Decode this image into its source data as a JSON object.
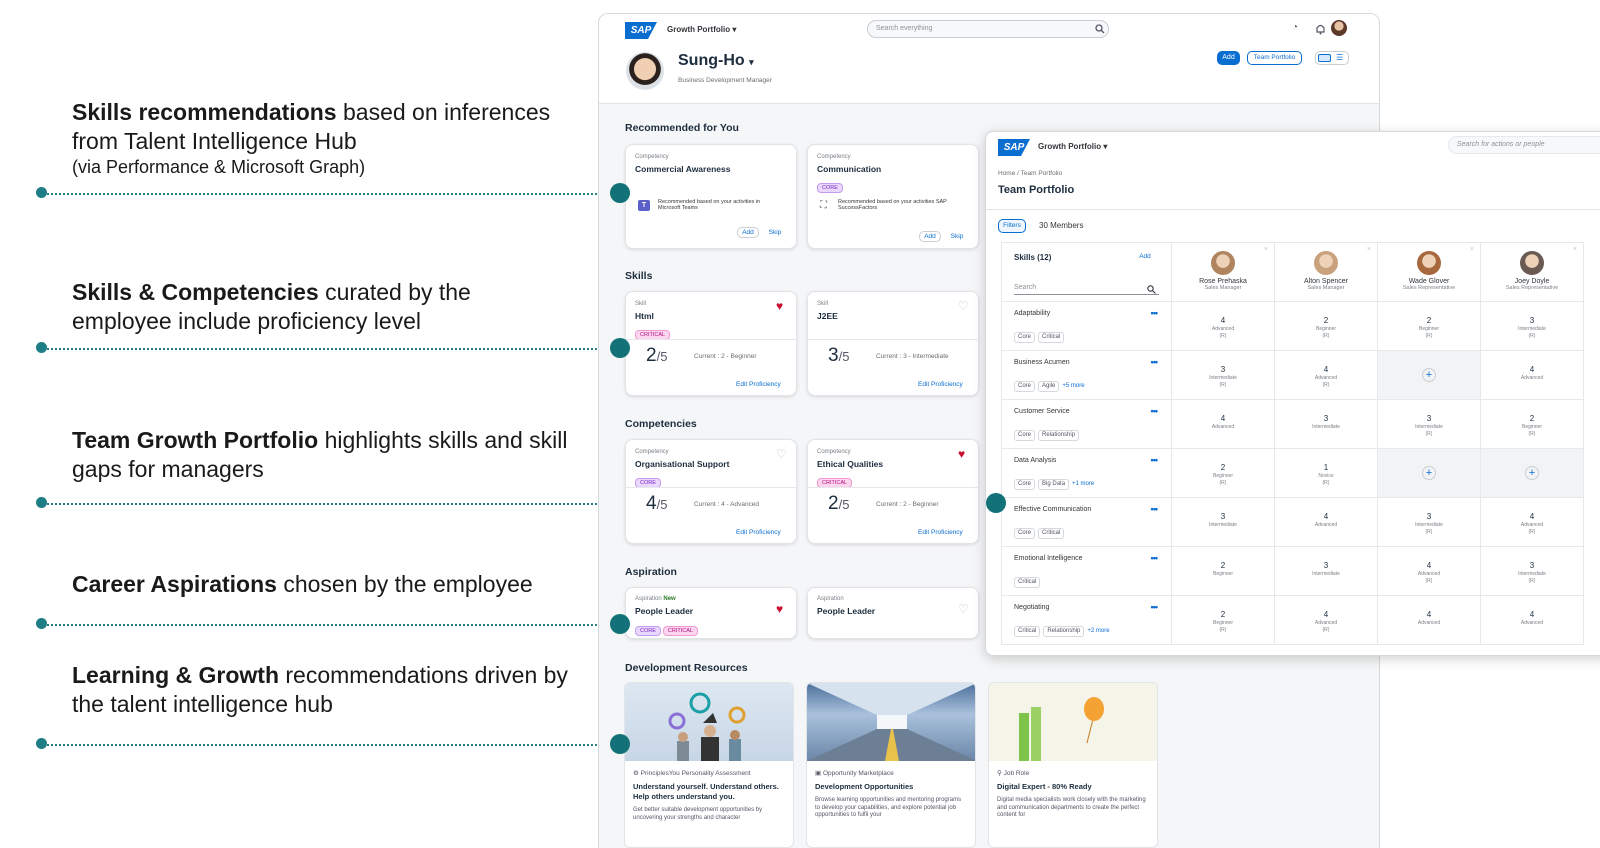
{
  "annotations": [
    {
      "bold": "Skills recommendations",
      "rest": " based on inferences from Talent Intelligence Hub",
      "sub": "(via Performance & Microsoft Graph)"
    },
    {
      "bold": "Skills & Competencies",
      "rest": " curated by the employee include proficiency level",
      "sub": ""
    },
    {
      "bold": "Team Growth Portfolio",
      "rest": " highlights skills and skill gaps for managers",
      "sub": ""
    },
    {
      "bold": "Career Aspirations",
      "rest": " chosen by the employee",
      "sub": ""
    },
    {
      "bold": "Learning & Growth",
      "rest": " recommendations driven by the talent intelligence hub",
      "sub": ""
    }
  ],
  "app": {
    "logo": "SAP",
    "product": "Growth Portfolio",
    "search_placeholder": "Search everything",
    "user_name": "Sung-Ho",
    "user_title": "Business Development Manager",
    "add_label": "Add",
    "team_portfolio_label": "Team Portfolio"
  },
  "recommended": {
    "title": "Recommended for You",
    "cards": [
      {
        "type": "Competency",
        "name": "Commercial Awareness",
        "tags": [],
        "reason": "Recommended based on your activities in Microsoft Teams",
        "add": "Add",
        "skip": "Skip"
      },
      {
        "type": "Competency",
        "name": "Communication",
        "tags": [
          "CORE"
        ],
        "reason": "Recommended based on your activities SAP SuccessFactors",
        "add": "Add",
        "skip": "Skip"
      }
    ]
  },
  "skills": {
    "title": "Skills",
    "cards": [
      {
        "type": "Skill",
        "name": "Html",
        "tag": "CRITICAL",
        "score": "2",
        "of": "/5",
        "current": "Current : 2 - Beginner",
        "edit": "Edit Proficiency",
        "fav": true
      },
      {
        "type": "Skill",
        "name": "J2EE",
        "tag": "",
        "score": "3",
        "of": "/5",
        "current": "Current : 3 - Intermediate",
        "edit": "Edit Proficiency",
        "fav": false
      }
    ]
  },
  "competencies": {
    "title": "Competencies",
    "cards": [
      {
        "type": "Competency",
        "name": "Organisational Support",
        "tag": "CORE",
        "score": "4",
        "of": "/5",
        "current": "Current : 4 - Advanced",
        "edit": "Edit Proficiency",
        "fav": false
      },
      {
        "type": "Competency",
        "name": "Ethical Qualities",
        "tag": "CRITICAL",
        "score": "2",
        "of": "/5",
        "current": "Current : 2 - Beginner",
        "edit": "Edit Proficiency",
        "fav": true
      }
    ]
  },
  "aspiration": {
    "title": "Aspiration",
    "cards": [
      {
        "type": "Aspiration",
        "badge": "New",
        "name": "People Leader",
        "tags": [
          "CORE",
          "CRITICAL"
        ],
        "fav": true
      },
      {
        "type": "Aspiration",
        "badge": "",
        "name": "People Leader",
        "tags": [],
        "fav": false
      }
    ]
  },
  "dev_resources": {
    "title": "Development Resources",
    "cards": [
      {
        "category": "PrinciplesYou Personality Assessment",
        "title": "Understand yourself. Understand others. Help others understand you.",
        "desc": "Get better suitable development opportunities by uncovering your strengths and character"
      },
      {
        "category": "Opportunity Marketplace",
        "title": "Development Opportunities",
        "desc": "Browse learning opportunities and mentoring programs to develop your capabilities, and explore potential job opportunities to fulfil your"
      },
      {
        "category": "Job Role",
        "title": "Digital Expert - 80% Ready",
        "desc": "Digital media specialists work closely with the marketing and communication departments to create the perfect content for"
      }
    ]
  },
  "team": {
    "logo": "SAP",
    "product": "Growth Portfolio",
    "search_placeholder": "Search for actions or people",
    "breadcrumb": "Home / Team Portfolio",
    "title": "Team Portfolio",
    "filters": "Filters",
    "members": "30 Members",
    "skills_header": "Skills (12)",
    "add": "Add",
    "search": "Search",
    "people": [
      {
        "name": "Rose Prehaska",
        "role": "Sales Manager",
        "color": "#b0845f"
      },
      {
        "name": "Alton Spencer",
        "role": "Sales Manager",
        "color": "#c9a27d"
      },
      {
        "name": "Wade Glover",
        "role": "Sales Representative",
        "color": "#a8683e"
      },
      {
        "name": "Joey Doyle",
        "role": "Sales Representative",
        "color": "#6b5a52"
      }
    ],
    "rows": [
      {
        "skill": "Adaptability",
        "tags": [
          "Core",
          "Critical"
        ],
        "more": "",
        "cells": [
          [
            "4",
            "Advanced",
            "(R)"
          ],
          [
            "2",
            "Beginner",
            "(R)"
          ],
          [
            "2",
            "Beginner",
            "(R)"
          ],
          [
            "3",
            "Intermediate",
            "(R)"
          ]
        ]
      },
      {
        "skill": "Business Acumen",
        "tags": [
          "Core",
          "Agile"
        ],
        "more": "+5 more",
        "cells": [
          [
            "3",
            "Intermediate",
            "(R)"
          ],
          [
            "4",
            "Advanced",
            "(R)"
          ],
          [
            "+",
            "",
            ""
          ],
          [
            "4",
            "Advanced",
            ""
          ]
        ]
      },
      {
        "skill": "Customer Service",
        "tags": [
          "Core",
          "Relationship"
        ],
        "more": "",
        "cells": [
          [
            "4",
            "Advanced",
            ""
          ],
          [
            "3",
            "Intermediate",
            ""
          ],
          [
            "3",
            "Intermediate",
            "(R)"
          ],
          [
            "2",
            "Beginner",
            "(R)"
          ]
        ]
      },
      {
        "skill": "Data Analysis",
        "tags": [
          "Core",
          "Big Data"
        ],
        "more": "+1 more",
        "cells": [
          [
            "2",
            "Beginner",
            "(R)"
          ],
          [
            "1",
            "Novice",
            "(R)"
          ],
          [
            "+",
            "",
            ""
          ],
          [
            "+",
            "",
            ""
          ]
        ]
      },
      {
        "skill": "Effective Communication",
        "tags": [
          "Core",
          "Critical"
        ],
        "more": "",
        "cells": [
          [
            "3",
            "Intermediate",
            ""
          ],
          [
            "4",
            "Advanced",
            ""
          ],
          [
            "3",
            "Intermediate",
            "(R)"
          ],
          [
            "4",
            "Advanced",
            "(R)"
          ]
        ]
      },
      {
        "skill": "Emotional Intelligence",
        "tags": [
          "Critical"
        ],
        "more": "",
        "cells": [
          [
            "2",
            "Beginner",
            ""
          ],
          [
            "3",
            "Intermediate",
            ""
          ],
          [
            "4",
            "Advanced",
            "(R)"
          ],
          [
            "3",
            "Intermediate",
            "(R)"
          ]
        ]
      },
      {
        "skill": "Negotiating",
        "tags": [
          "Critical",
          "Relationship"
        ],
        "more": "+2 more",
        "cells": [
          [
            "2",
            "Beginner",
            "(R)"
          ],
          [
            "4",
            "Advanced",
            "(R)"
          ],
          [
            "4",
            "Advanced",
            ""
          ],
          [
            "4",
            "Advanced",
            ""
          ]
        ]
      }
    ]
  }
}
